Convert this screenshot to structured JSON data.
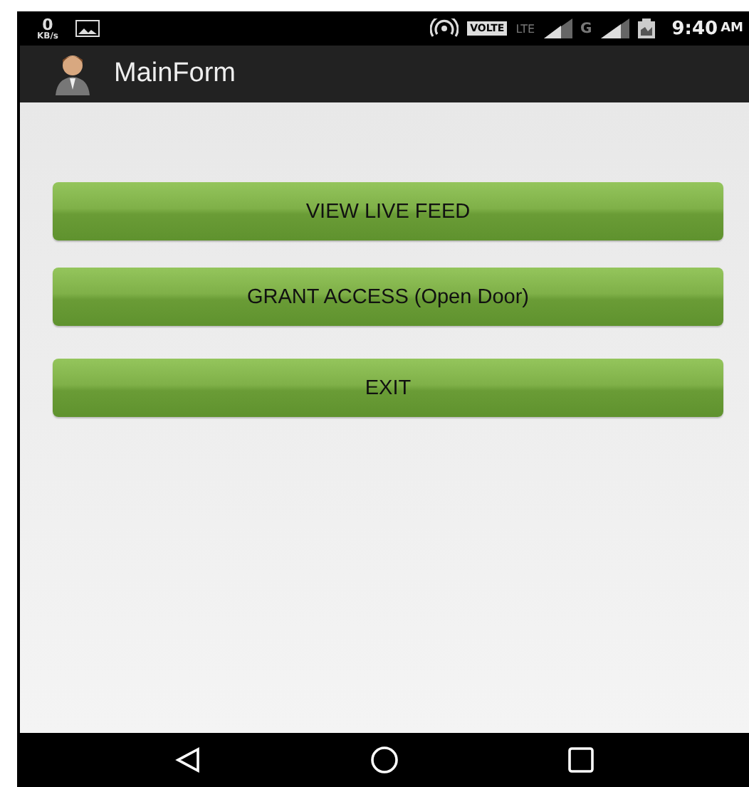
{
  "status_bar": {
    "speed_value": "0",
    "speed_unit": "KB/s",
    "volte": "VOLTE",
    "lte": "LTE",
    "network": "G",
    "time": "9:40",
    "meridiem": "AM"
  },
  "app_bar": {
    "title": "MainForm"
  },
  "buttons": [
    {
      "label": "VIEW LIVE FEED"
    },
    {
      "label": "GRANT ACCESS (Open Door)"
    },
    {
      "label": "EXIT"
    }
  ]
}
